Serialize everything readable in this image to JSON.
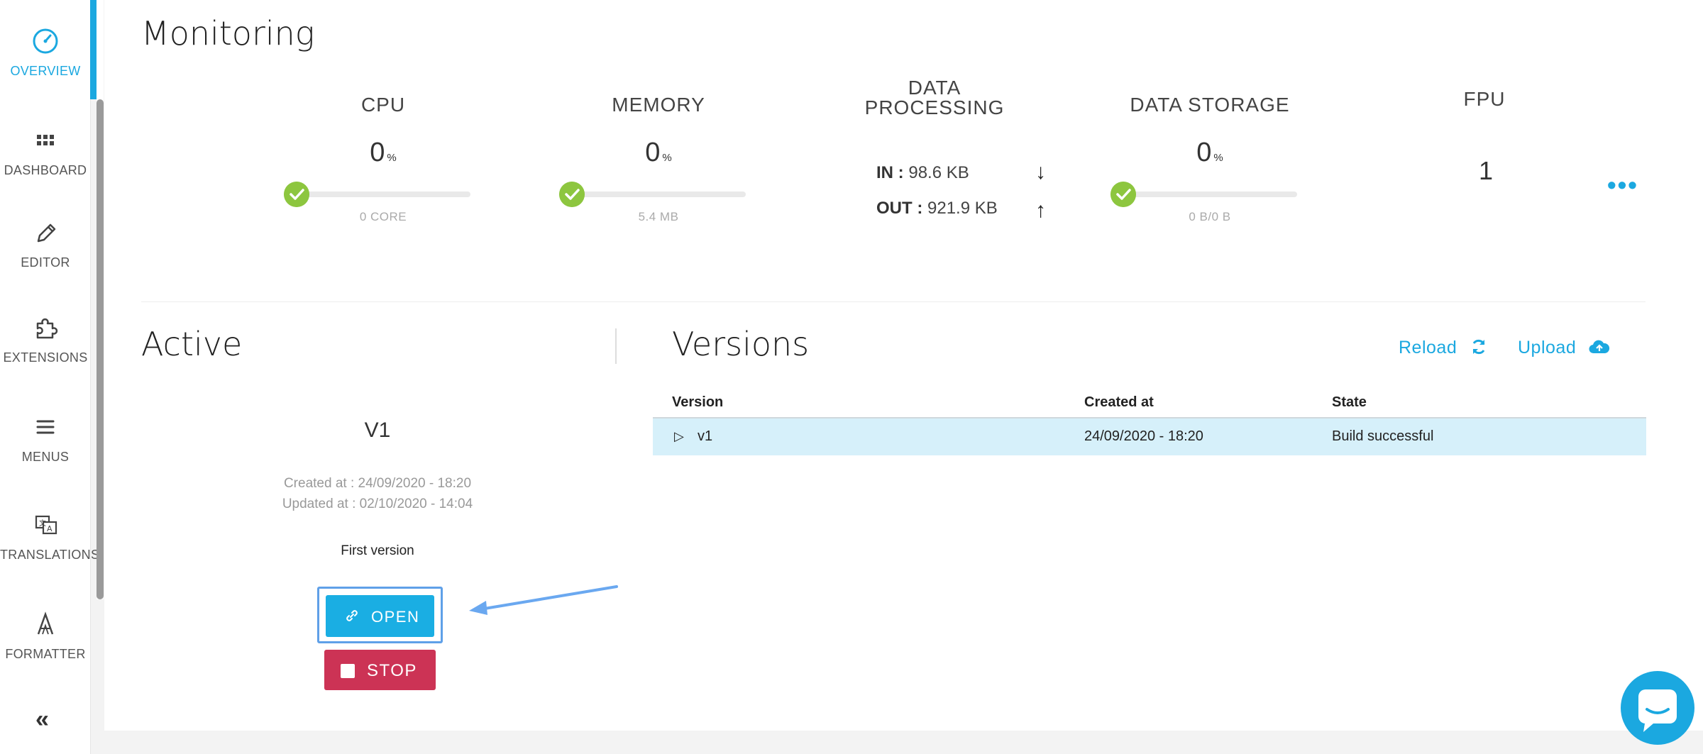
{
  "sidebar": {
    "items": [
      {
        "label": "OVERVIEW",
        "icon": "speedometer-icon",
        "active": true
      },
      {
        "label": "DASHBOARD",
        "icon": "grid-icon"
      },
      {
        "label": "EDITOR",
        "icon": "pencil-icon"
      },
      {
        "label": "EXTENSIONS",
        "icon": "puzzle-icon"
      },
      {
        "label": "MENUS",
        "icon": "menu-icon"
      },
      {
        "label": "TRANSLATIONS",
        "icon": "translate-icon"
      },
      {
        "label": "FORMATTER",
        "icon": "font-icon"
      }
    ],
    "collapse_label": "«"
  },
  "monitoring": {
    "title": "Monitoring",
    "cpu": {
      "title": "CPU",
      "value": "0",
      "unit": "%",
      "sub": "0 CORE",
      "level": 0
    },
    "memory": {
      "title": "MEMORY",
      "value": "0",
      "unit": "%",
      "sub": "5.4 MB",
      "level": 0
    },
    "data_processing": {
      "title_line1": "DATA",
      "title_line2": "PROCESSING",
      "in_label": "IN :",
      "in_value": "98.6 KB",
      "out_label": "OUT :",
      "out_value": "921.9 KB",
      "in_arrow": "↓",
      "out_arrow": "↑"
    },
    "data_storage": {
      "title": "DATA STORAGE",
      "value": "0",
      "unit": "%",
      "sub": "0 B/0 B",
      "level": 0
    },
    "fpu": {
      "title": "FPU",
      "value": "1"
    },
    "more_label": "•••"
  },
  "active": {
    "title": "Active",
    "version_name": "V1",
    "created": "Created at : 24/09/2020 - 18:20",
    "updated": "Updated at : 02/10/2020 - 14:04",
    "description": "First version",
    "open_label": "OPEN",
    "stop_label": "STOP"
  },
  "versions": {
    "title": "Versions",
    "reload_label": "Reload",
    "upload_label": "Upload",
    "columns": [
      "Version",
      "Created at",
      "State"
    ],
    "rows": [
      {
        "version": "v1",
        "created": "24/09/2020 - 18:20",
        "state": "Build successful"
      }
    ]
  },
  "colors": {
    "accent": "#1ba8e0",
    "success": "#8dc63f",
    "danger": "#cc3355",
    "selected_row": "#d6f0fa"
  }
}
